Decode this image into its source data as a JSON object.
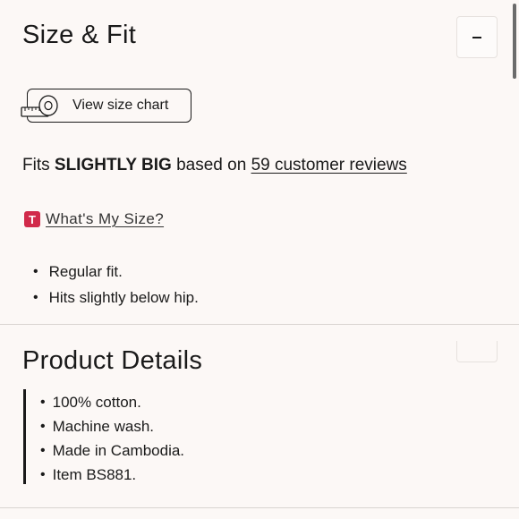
{
  "size_fit": {
    "title": "Size & Fit",
    "toggle_label": "-",
    "size_chart_label": "View size chart",
    "fits_prefix": "Fits",
    "fits_value": "SLIGHTLY BIG",
    "fits_middle": "based on",
    "reviews_link": "59 customer reviews",
    "whats_my_size_icon": "T",
    "whats_my_size_link": "What's My Size?",
    "fit_notes": [
      "Regular fit.",
      "Hits slightly below hip."
    ]
  },
  "product_details": {
    "title": "Product Details",
    "items": [
      "100% cotton.",
      "Machine wash.",
      "Made in Cambodia.",
      "Item BS881."
    ]
  },
  "icons": {
    "toggle": "minus-icon",
    "size_chart": "measuring-tape-icon",
    "whats_my_size": "true-fit-icon"
  },
  "colors": {
    "background": "#fcf8f6",
    "text": "#1a1a1a",
    "true_fit_accent": "#d12a4a"
  }
}
